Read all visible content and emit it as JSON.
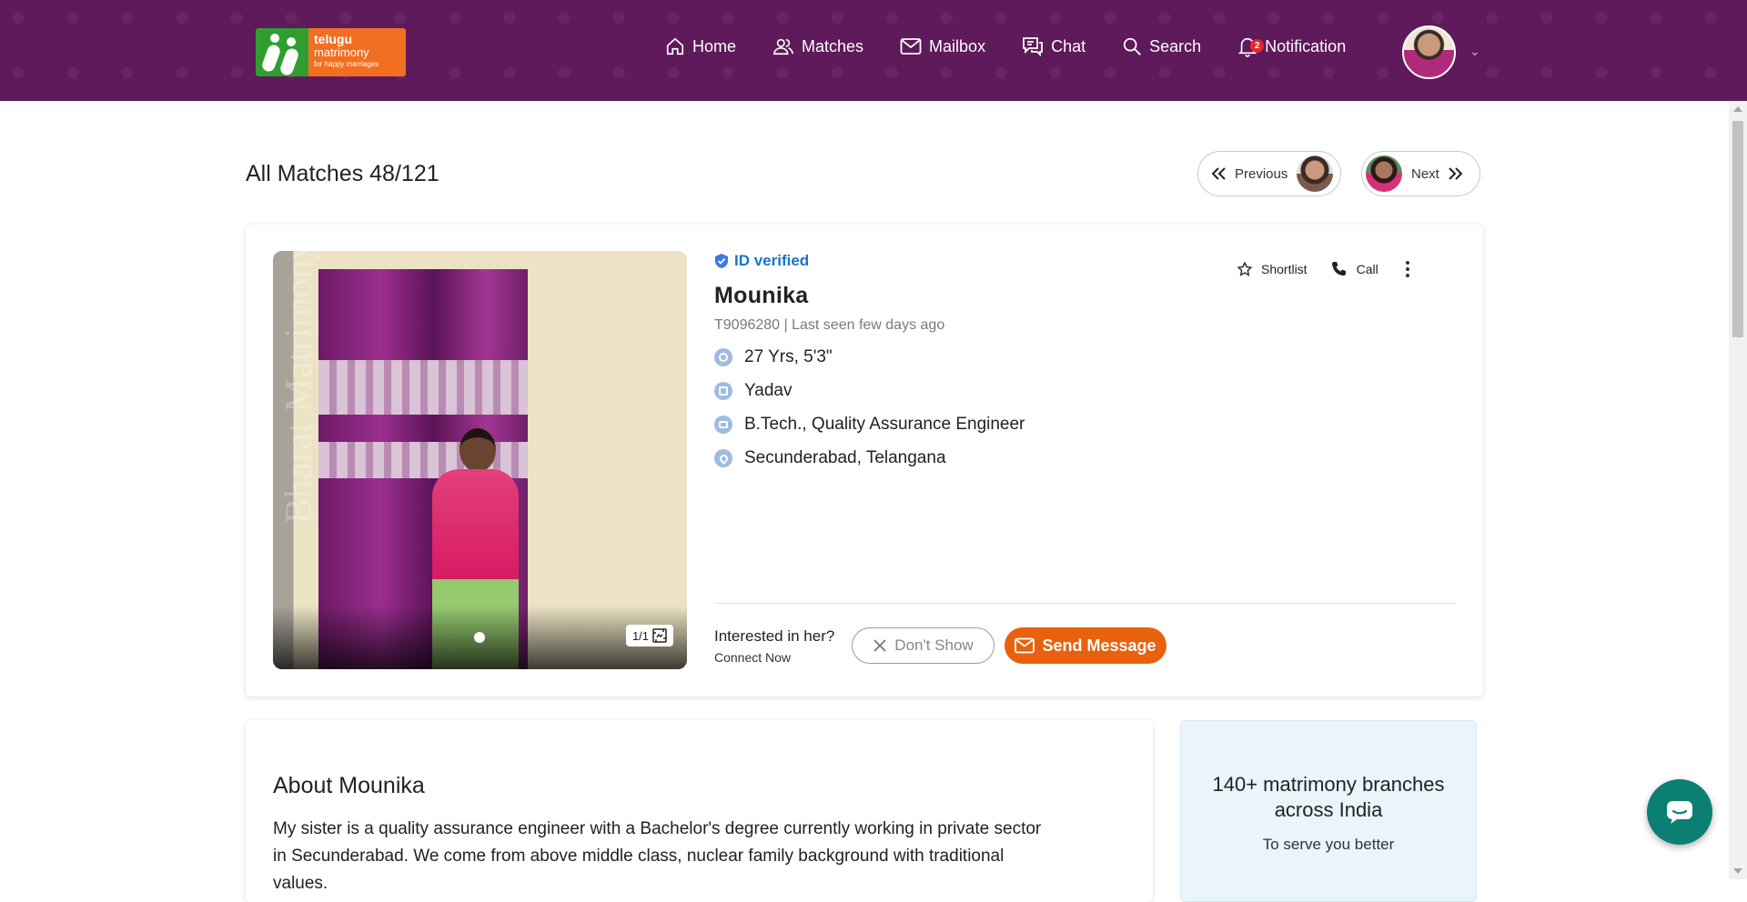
{
  "logo": {
    "line1": "telugu",
    "line2": "matrimony",
    "tagline": "for happy marriages"
  },
  "nav": {
    "home": "Home",
    "matches": "Matches",
    "mailbox": "Mailbox",
    "chat": "Chat",
    "search": "Search",
    "notification": "Notification",
    "notification_count": "2"
  },
  "header": {
    "title": "All Matches 48/121",
    "prev_label": "Previous",
    "next_label": "Next"
  },
  "profile": {
    "verified_label": "ID verified",
    "name": "Mounika",
    "id_line": "T9096280 | Last seen few days ago",
    "age_height": "27 Yrs, 5'3\"",
    "caste": "Yadav",
    "education_job": "B.Tech., Quality Assurance Engineer",
    "location": "Secunderabad, Telangana",
    "photo_counter": "1/1",
    "photo_watermark": "Bharat Matrimony.com"
  },
  "actions": {
    "shortlist": "Shortlist",
    "call": "Call"
  },
  "interest": {
    "question": "Interested in her?",
    "sub": "Connect Now",
    "dont_show": "Don't Show",
    "send_message": "Send Message"
  },
  "about": {
    "title": "About Mounika",
    "text": "My sister is a quality assurance engineer with a Bachelor's degree currently working in private sector in Secunderabad. We come from above middle class, nuclear family background with traditional values."
  },
  "branches": {
    "title": "140+ matrimony branches across India",
    "subtitle": "To serve you better"
  },
  "colors": {
    "header_bg": "#5e1a5a",
    "accent": "#e8610e",
    "verified": "#1a73c8",
    "chat_fab": "#0b7f73"
  }
}
